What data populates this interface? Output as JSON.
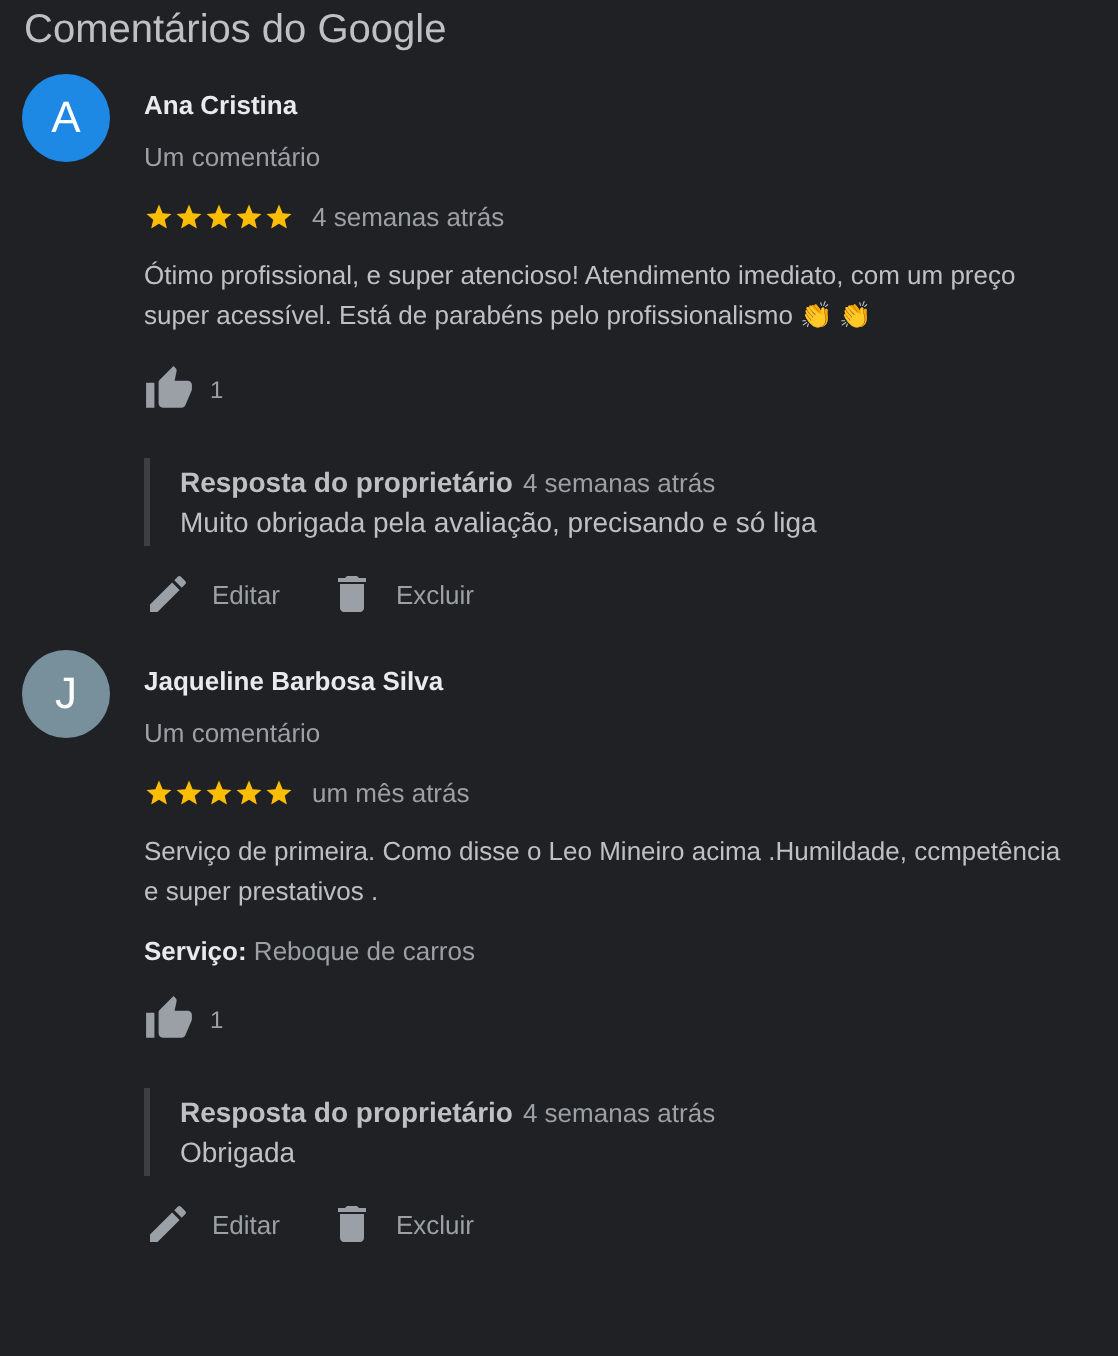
{
  "title": "Comentários do Google",
  "reviews": [
    {
      "initial": "A",
      "color": "#1e88e5",
      "name": "Ana Cristina",
      "count": "Um comentário",
      "stars": 5,
      "time": "4 semanas atrás",
      "text": "Ótimo profissional, e super atencioso! Atendimento imediato, com um preço super acessível. Está de parabéns pelo profissionalismo 👏 👏",
      "likes": "1",
      "reply": {
        "label": "Resposta do proprietário",
        "time": "4 semanas atrás",
        "text": "Muito obrigada pela avaliação, precisando e só liga"
      },
      "actions": [
        {
          "kind": "edit",
          "label": "Editar"
        },
        {
          "kind": "delete",
          "label": "Excluir"
        }
      ]
    },
    {
      "initial": "J",
      "color": "#78909c",
      "name": "Jaqueline Barbosa Silva",
      "count": "Um comentário",
      "stars": 5,
      "time": "um mês atrás",
      "text": "Serviço de primeira. Como disse o Leo Mineiro acima .Humildade, ccmpetência e super prestativos .",
      "service": "**Serviço:** Reboque de carros",
      "likes": "1",
      "reply": {
        "label": "Resposta do proprietário",
        "time": "4 semanas atrás",
        "text": "Obrigada"
      },
      "actions": [
        {
          "kind": "edit",
          "label": "Editar"
        },
        {
          "kind": "delete",
          "label": "Excluir"
        }
      ]
    }
  ]
}
